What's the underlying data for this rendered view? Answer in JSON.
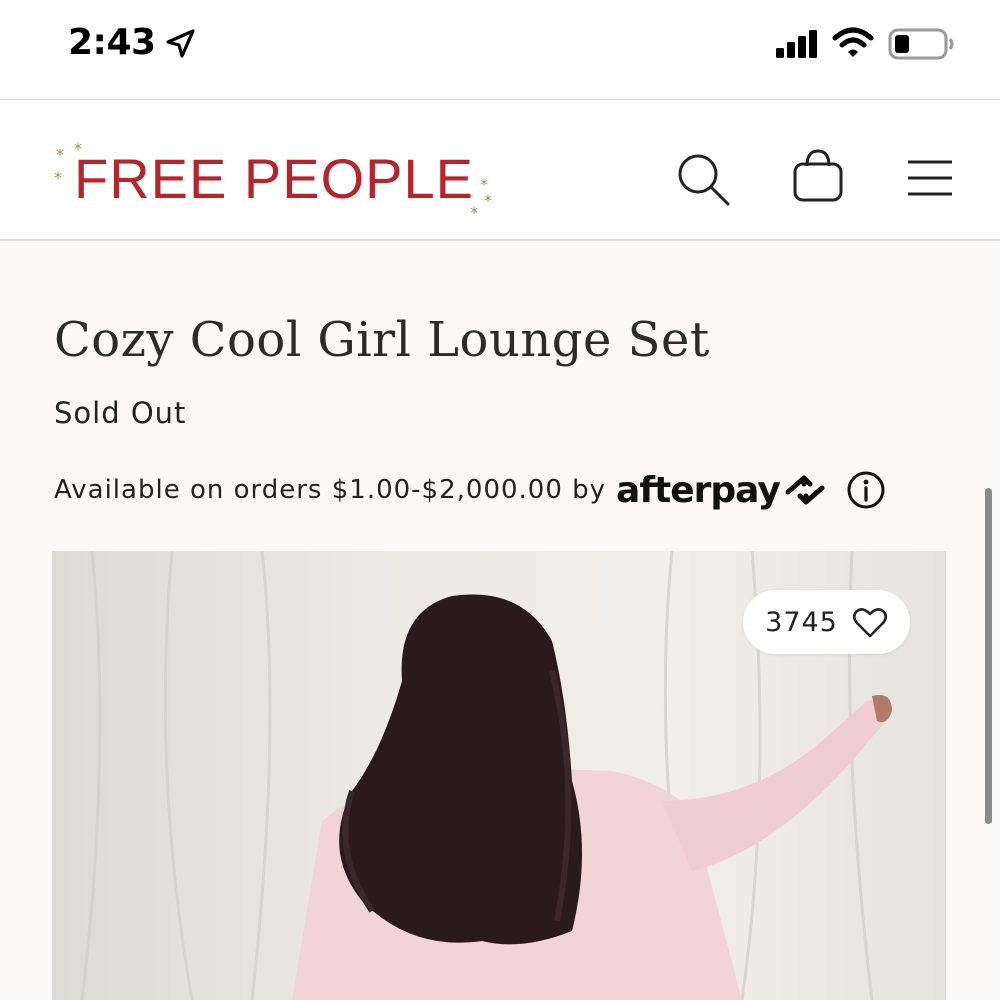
{
  "status_bar": {
    "time": "2:43"
  },
  "header": {
    "logo_text": "FREE PEOPLE",
    "brand_color": "#b3262b",
    "icons": [
      "search-icon",
      "bag-icon",
      "menu-icon"
    ]
  },
  "product": {
    "title": "Cozy Cool Girl Lounge Set",
    "stock_status": "Sold Out",
    "afterpay_text": "Available on orders $1.00-$2,000.00 by",
    "afterpay_brand": "afterpay",
    "like_count": "3745"
  }
}
